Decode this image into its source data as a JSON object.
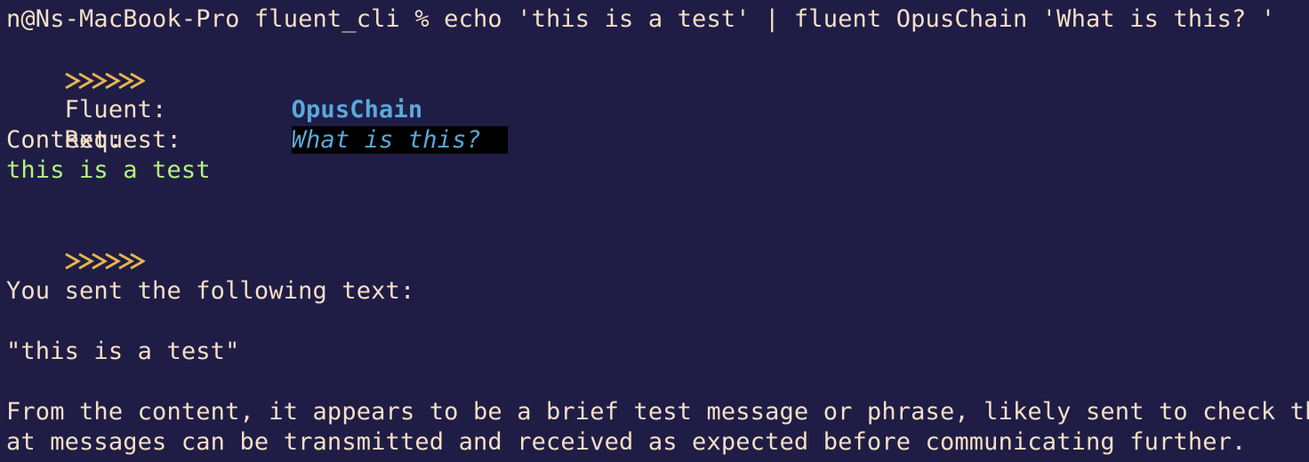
{
  "terminal": {
    "prompt_line": "n@Ns-MacBook-Pro fluent_cli % echo 'this is a test' | fluent OpusChain 'What is this? '",
    "header_marker_icon": "chevron-arrows-icon",
    "fluent_label": "Fluent:",
    "fluent_value": "OpusChain",
    "request_label": "Request:",
    "request_value": "What is this? ",
    "context_label": "Context:",
    "context_value": "this is a test",
    "response_marker_icon": "chevron-arrows-icon",
    "response_lines": [
      "You sent the following text:",
      "\"this is a test\"",
      "From the content, it appears to be a brief test message or phrase, likely sent to check that",
      "at messages can be transmitted and received as expected before communicating further."
    ],
    "colors": {
      "background": "#1f1d45",
      "foreground": "#f5dfc6",
      "agent_blue": "#5aa8d9",
      "context_green": "#b4f27f",
      "chevron_gold": "#e8b54a"
    }
  }
}
